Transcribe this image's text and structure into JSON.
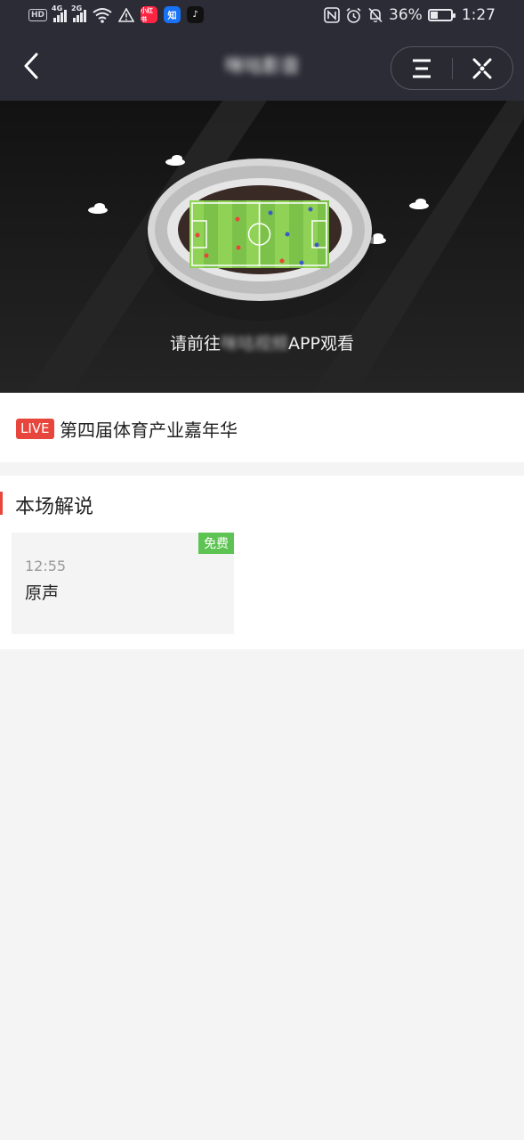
{
  "status_bar": {
    "left_badges": [
      "HD",
      "4G",
      "2G"
    ],
    "apps": [
      {
        "name": "xiaohongshu-icon",
        "label": "小红书",
        "color": "#ff2442"
      },
      {
        "name": "zhihu-icon",
        "label": "知",
        "color": "#1772f6"
      },
      {
        "name": "douyin-icon",
        "label": "♪",
        "color": "#111111"
      }
    ],
    "battery_percent": "36%",
    "battery_level": 0.36,
    "time": "1:27"
  },
  "nav": {
    "title": "咪咕影音"
  },
  "banner": {
    "prompt_prefix": "请前往",
    "prompt_app_blurred": "咪咕视频",
    "prompt_suffix": "APP观看"
  },
  "event": {
    "live_label": "LIVE",
    "title": "第四届体育产业嘉年华"
  },
  "commentary": {
    "section_title": "本场解说",
    "items": [
      {
        "tag": "免费",
        "time": "12:55",
        "name": "原声"
      }
    ]
  },
  "colors": {
    "nav_bg": "#2c2c36",
    "accent_red": "#e8453c",
    "free_green": "#5dc352",
    "page_bg": "#f4f4f4"
  }
}
